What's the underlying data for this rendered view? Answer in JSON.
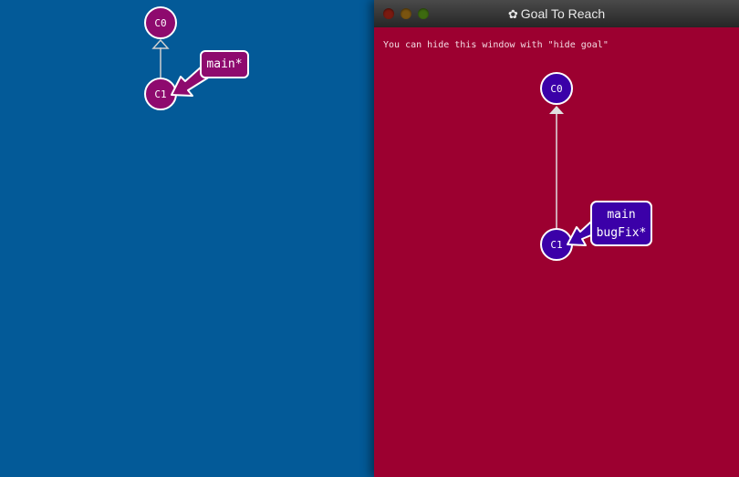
{
  "main_view": {
    "commits": [
      {
        "id": "C0",
        "label": "C0"
      },
      {
        "id": "C1",
        "label": "C1"
      }
    ],
    "branch_labels": [
      "main*"
    ],
    "colors": {
      "background": "#035a98",
      "commit": "#8e0a6e",
      "branch_box": "#8e0a6e"
    }
  },
  "goal_window": {
    "title": "Goal To Reach",
    "title_icon": "gear-icon",
    "hint": "You can hide this window with \"hide goal\"",
    "commits": [
      {
        "id": "C0",
        "label": "C0"
      },
      {
        "id": "C1",
        "label": "C1"
      }
    ],
    "branch_labels": [
      "main",
      "bugFix*"
    ],
    "colors": {
      "background": "#9c0030",
      "commit": "#3b00a8",
      "branch_box": "#3b00a8"
    }
  }
}
